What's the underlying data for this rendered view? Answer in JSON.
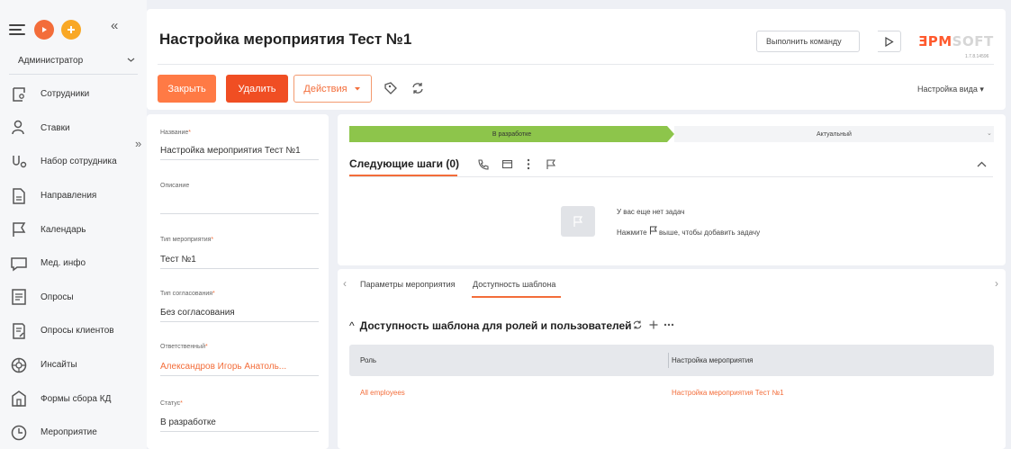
{
  "sidebar": {
    "role": "Администратор",
    "items": [
      {
        "label": "Сотрудники",
        "icon": "employees-icon"
      },
      {
        "label": "Ставки",
        "icon": "rates-icon"
      },
      {
        "label": "Набор сотрудника",
        "icon": "recruitment-icon"
      },
      {
        "label": "Направления",
        "icon": "directions-icon"
      },
      {
        "label": "Календарь",
        "icon": "calendar-icon"
      },
      {
        "label": "Мед. инфо",
        "icon": "med-info-icon"
      },
      {
        "label": "Опросы",
        "icon": "surveys-icon"
      },
      {
        "label": "Опросы клиентов",
        "icon": "client-surveys-icon"
      },
      {
        "label": "Инсайты",
        "icon": "insights-icon"
      },
      {
        "label": "Формы сбора КД",
        "icon": "forms-icon"
      },
      {
        "label": "Мероприятие",
        "icon": "event-icon"
      }
    ]
  },
  "header": {
    "title": "Настройка мероприятия Тест №1",
    "command_placeholder": "Выполнить команду",
    "logo_part1": "ƎPM",
    "logo_part2": "SOFT",
    "version": "1.7.8.14596",
    "close_label": "Закрыть",
    "delete_label": "Удалить",
    "actions_label": "Действия",
    "view_label": "Настройка вида"
  },
  "form": {
    "name_label": "Название",
    "name_value": "Настройка мероприятия Тест №1",
    "desc_label": "Описание",
    "type_label": "Тип мероприятия",
    "type_value": "Тест №1",
    "approval_label": "Тип согласования",
    "approval_value": "Без согласования",
    "owner_label": "Ответственный",
    "owner_value": "Александров Игорь Анатоль...",
    "status_label": "Статус",
    "status_value": "В разработке"
  },
  "stages": {
    "current": "В разработке",
    "next": "Актуальный"
  },
  "next_steps": {
    "title": "Следующие шаги (0)",
    "empty_line1": "У вас еще нет задач",
    "empty_line2_a": "Нажмите",
    "empty_line2_b": "выше, чтобы добавить задачу"
  },
  "tabs": {
    "items": [
      "Параметры мероприятия",
      "Доступность шаблона"
    ],
    "active": 1
  },
  "availability": {
    "title": "Доступность шаблона для ролей и пользователей",
    "columns": [
      "Роль",
      "Настройка мероприятия"
    ],
    "rows": [
      [
        "All employees",
        "Настройка мероприятия Тест №1"
      ]
    ]
  },
  "colors": {
    "accent": "#f36d3a",
    "stage_active": "#8dc54b",
    "delete": "#f04e23"
  }
}
